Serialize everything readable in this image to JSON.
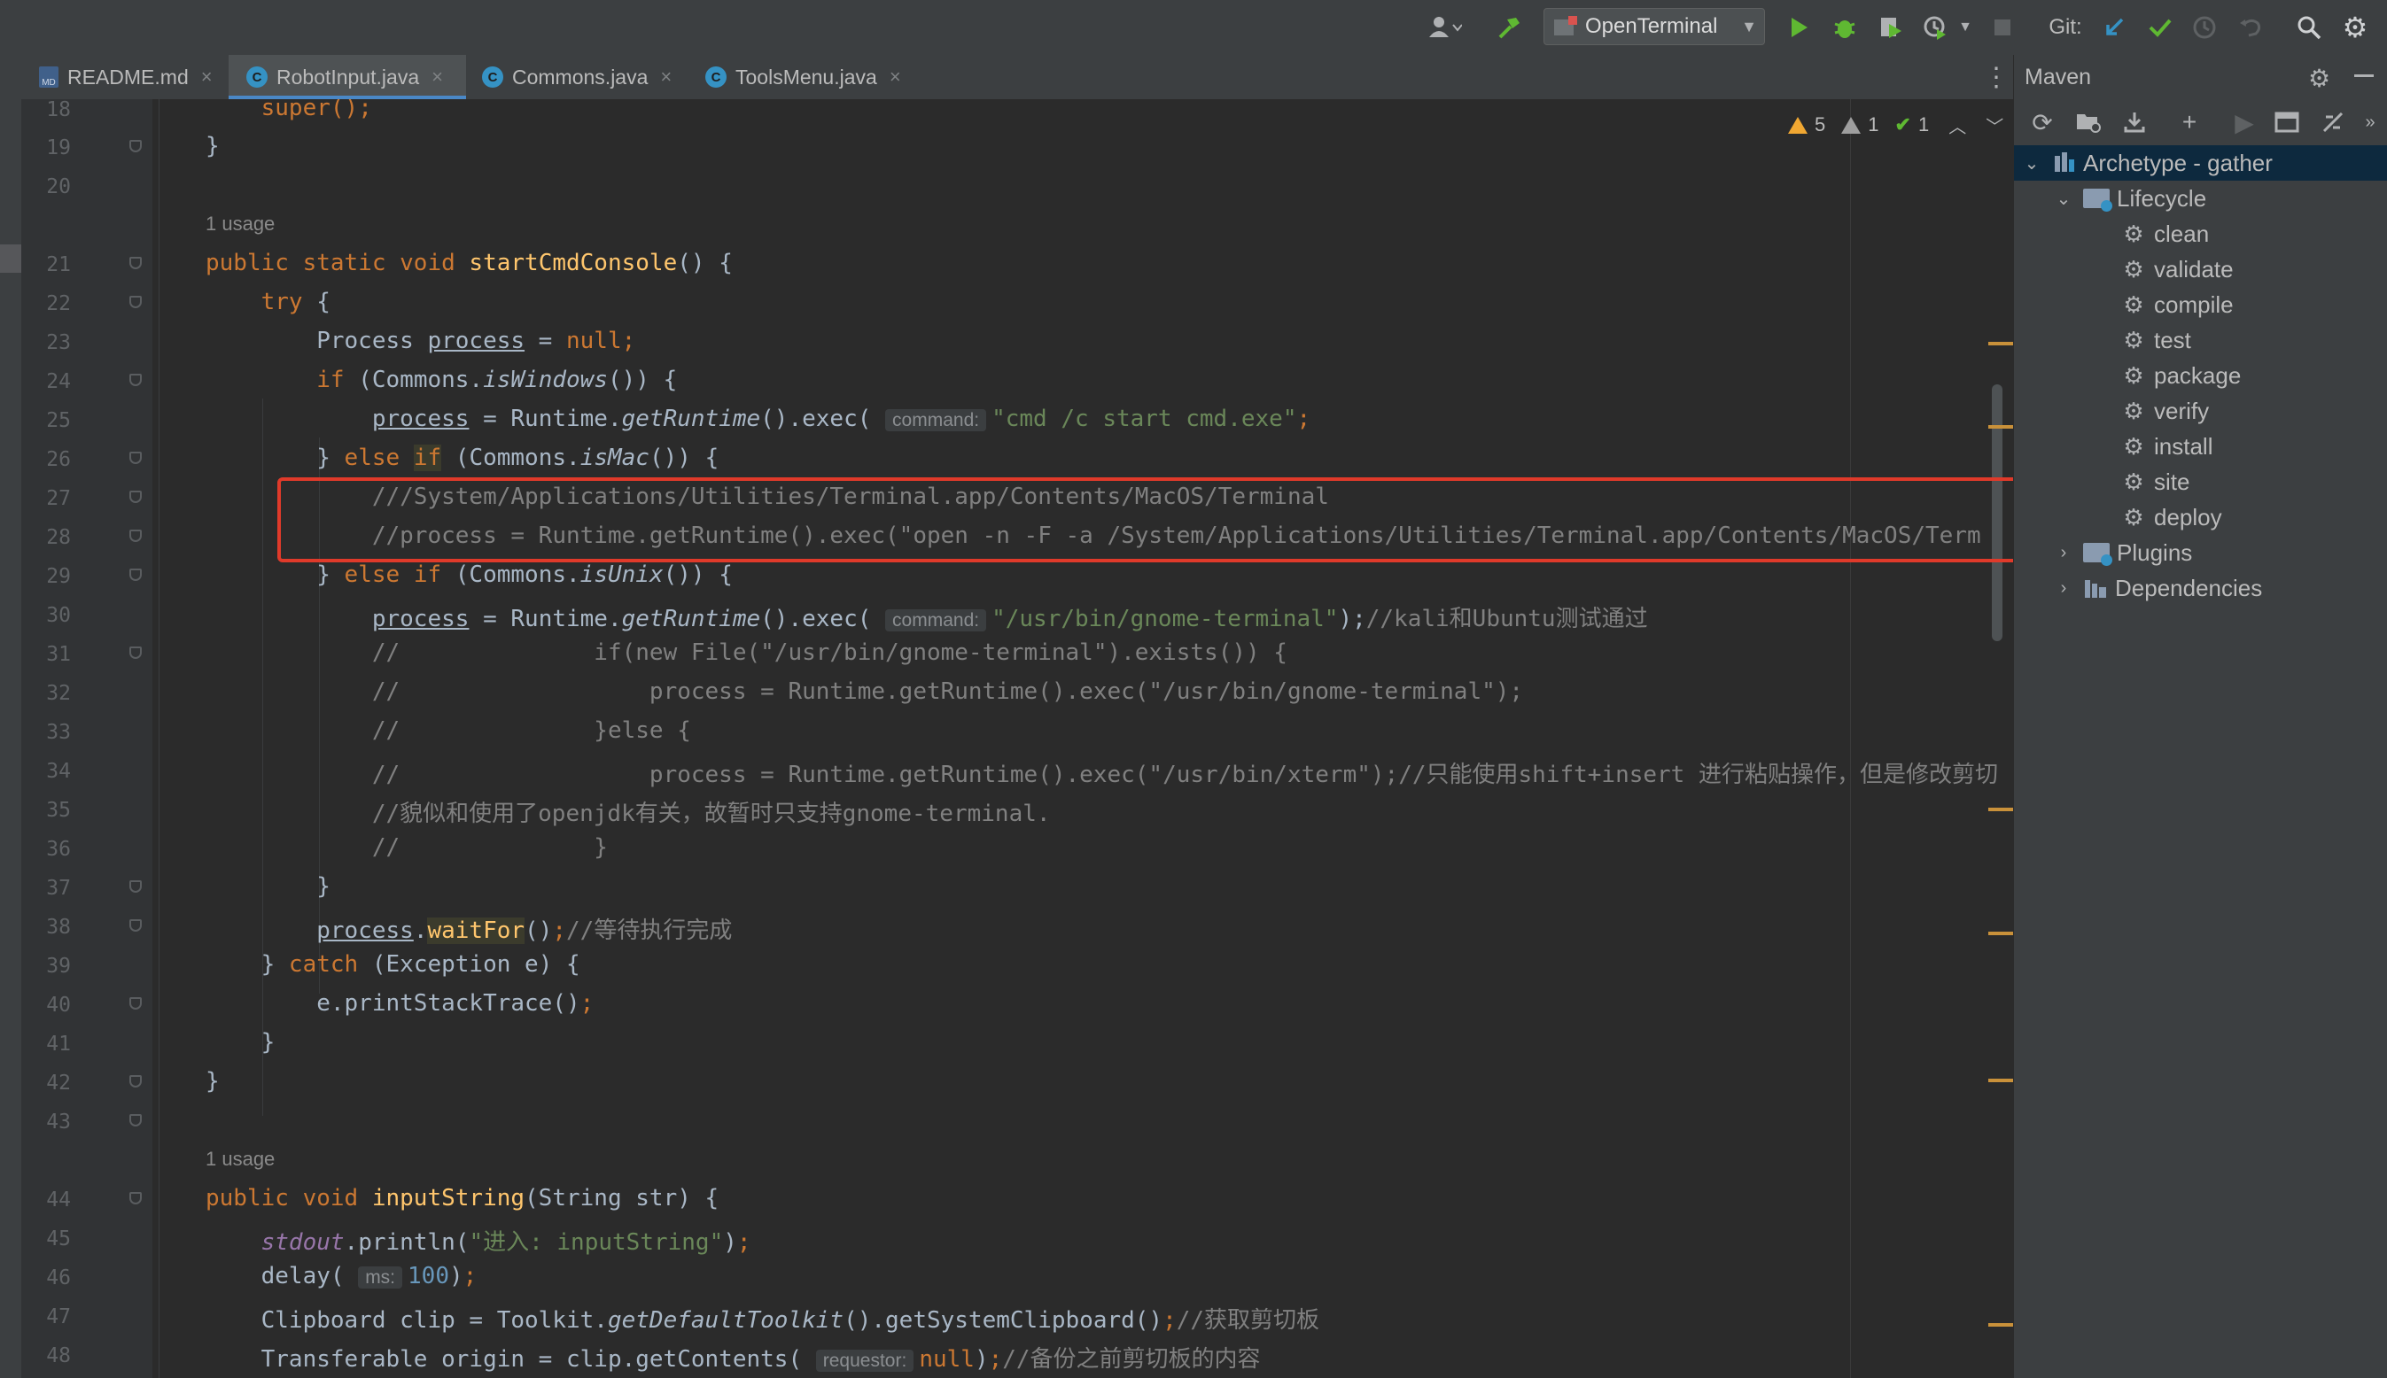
{
  "toolbar": {
    "run_config": "OpenTerminal",
    "git_label": "Git:",
    "icons": [
      "user-icon",
      "build-hammer-icon",
      "run-icon",
      "debug-bug-icon",
      "coverage-icon",
      "profile-icon",
      "stop-icon",
      "git-update-icon",
      "git-commit-check-icon",
      "git-history-icon",
      "git-rollback-icon",
      "search-icon",
      "settings-gear-icon"
    ]
  },
  "tabs": [
    {
      "label": "README.md",
      "close": "×",
      "icon": "md-file-icon"
    },
    {
      "label": "RobotInput.java",
      "close": "×",
      "icon": "java-class-icon",
      "active": true
    },
    {
      "label": "Commons.java",
      "close": "×",
      "icon": "java-class-icon"
    },
    {
      "label": "ToolsMenu.java",
      "close": "×",
      "icon": "java-class-icon"
    }
  ],
  "inspections": {
    "warnings": "5",
    "weak_warnings": "1",
    "ok": "1"
  },
  "editor": {
    "usage_hint_1": "1 usage",
    "usage_hint_2": "1 usage",
    "line_numbers": [
      "18",
      "19",
      "20",
      "21",
      "22",
      "23",
      "24",
      "25",
      "26",
      "27",
      "28",
      "29",
      "30",
      "31",
      "32",
      "33",
      "34",
      "35",
      "36",
      "37",
      "38",
      "39",
      "40",
      "41",
      "42",
      "43",
      "44",
      "45",
      "46",
      "47",
      "48"
    ],
    "hints": {
      "command": "command:",
      "ms": "ms:",
      "requestor": "requestor:"
    },
    "text": {
      "l18": "super();",
      "l19": "}",
      "l21_sig": "startCmdConsole",
      "l23_null": "null;",
      "l25_str": "\"cmd /c start cmd.exe\"",
      "l27": "///System/Applications/Utilities/Terminal.app/Contents/MacOS/Terminal",
      "l28": "//process = Runtime.getRuntime().exec(\"open -n -F -a /System/Applications/Utilities/Terminal.app/Contents/MacOS/Term",
      "l30_str": "\"/usr/bin/gnome-terminal\"",
      "l30_cm": "//kali和Ubuntu测试通过",
      "l31": "//              if(new File(\"/usr/bin/gnome-terminal\").exists()) {",
      "l32": "//                  process = Runtime.getRuntime().exec(\"/usr/bin/gnome-terminal\");",
      "l33": "//              }else {",
      "l34": "//                  process = Runtime.getRuntime().exec(\"/usr/bin/xterm\");//只能使用shift+insert 进行粘贴操作，但是修改剪切",
      "l35": "//貌似和使用了openjdk有关，故暂时只支持gnome-terminal.",
      "l36": "//              }",
      "l38_cm": "//等待执行完成",
      "l44_sig": "inputString",
      "l45_str": "\"进入: inputString\"",
      "l46_num": "100",
      "l47_cm": "//获取剪切板",
      "l48_cm": "//备份之前剪切板的内容"
    }
  },
  "maven": {
    "title": "Maven",
    "project": "Archetype - gather",
    "lifecycle": "Lifecycle",
    "goals": [
      "clean",
      "validate",
      "compile",
      "test",
      "package",
      "verify",
      "install",
      "site",
      "deploy"
    ],
    "plugins": "Plugins",
    "dependencies": "Dependencies"
  },
  "colors": {
    "accent": "#4a88c7",
    "highlight_box": "#e03a2a",
    "warning": "#f0a732",
    "keyword": "#cc7832",
    "string": "#6a8759",
    "function": "#ffc66d"
  }
}
